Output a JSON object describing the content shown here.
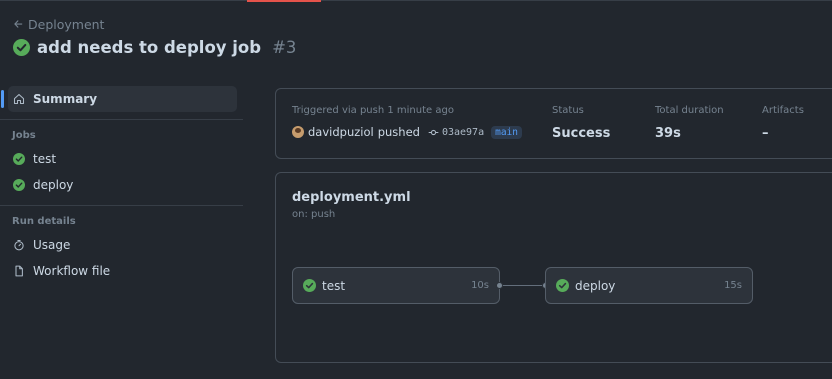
{
  "header": {
    "back_label": "Deployment",
    "title": "add needs to deploy job",
    "run_number": "#3"
  },
  "sidebar": {
    "summary_label": "Summary",
    "jobs_section": "Jobs",
    "jobs": [
      {
        "label": "test",
        "status": "success"
      },
      {
        "label": "deploy",
        "status": "success"
      }
    ],
    "run_details_section": "Run details",
    "details": [
      {
        "label": "Usage",
        "icon": "stopwatch-icon"
      },
      {
        "label": "Workflow file",
        "icon": "file-icon"
      }
    ]
  },
  "summary": {
    "trigger_label": "Triggered via push 1 minute ago",
    "actor": "davidpuziol",
    "action": "pushed",
    "commit": "03ae97a",
    "branch": "main",
    "status_label": "Status",
    "status_value": "Success",
    "duration_label": "Total duration",
    "duration_value": "39s",
    "artifacts_label": "Artifacts",
    "artifacts_value": "–"
  },
  "workflow": {
    "file": "deployment.yml",
    "trigger": "on: push",
    "jobs": [
      {
        "name": "test",
        "duration": "10s"
      },
      {
        "name": "deploy",
        "duration": "15s"
      }
    ]
  },
  "colors": {
    "success": "#57ab5a",
    "accent": "#539bf5",
    "background": "#22272e"
  }
}
